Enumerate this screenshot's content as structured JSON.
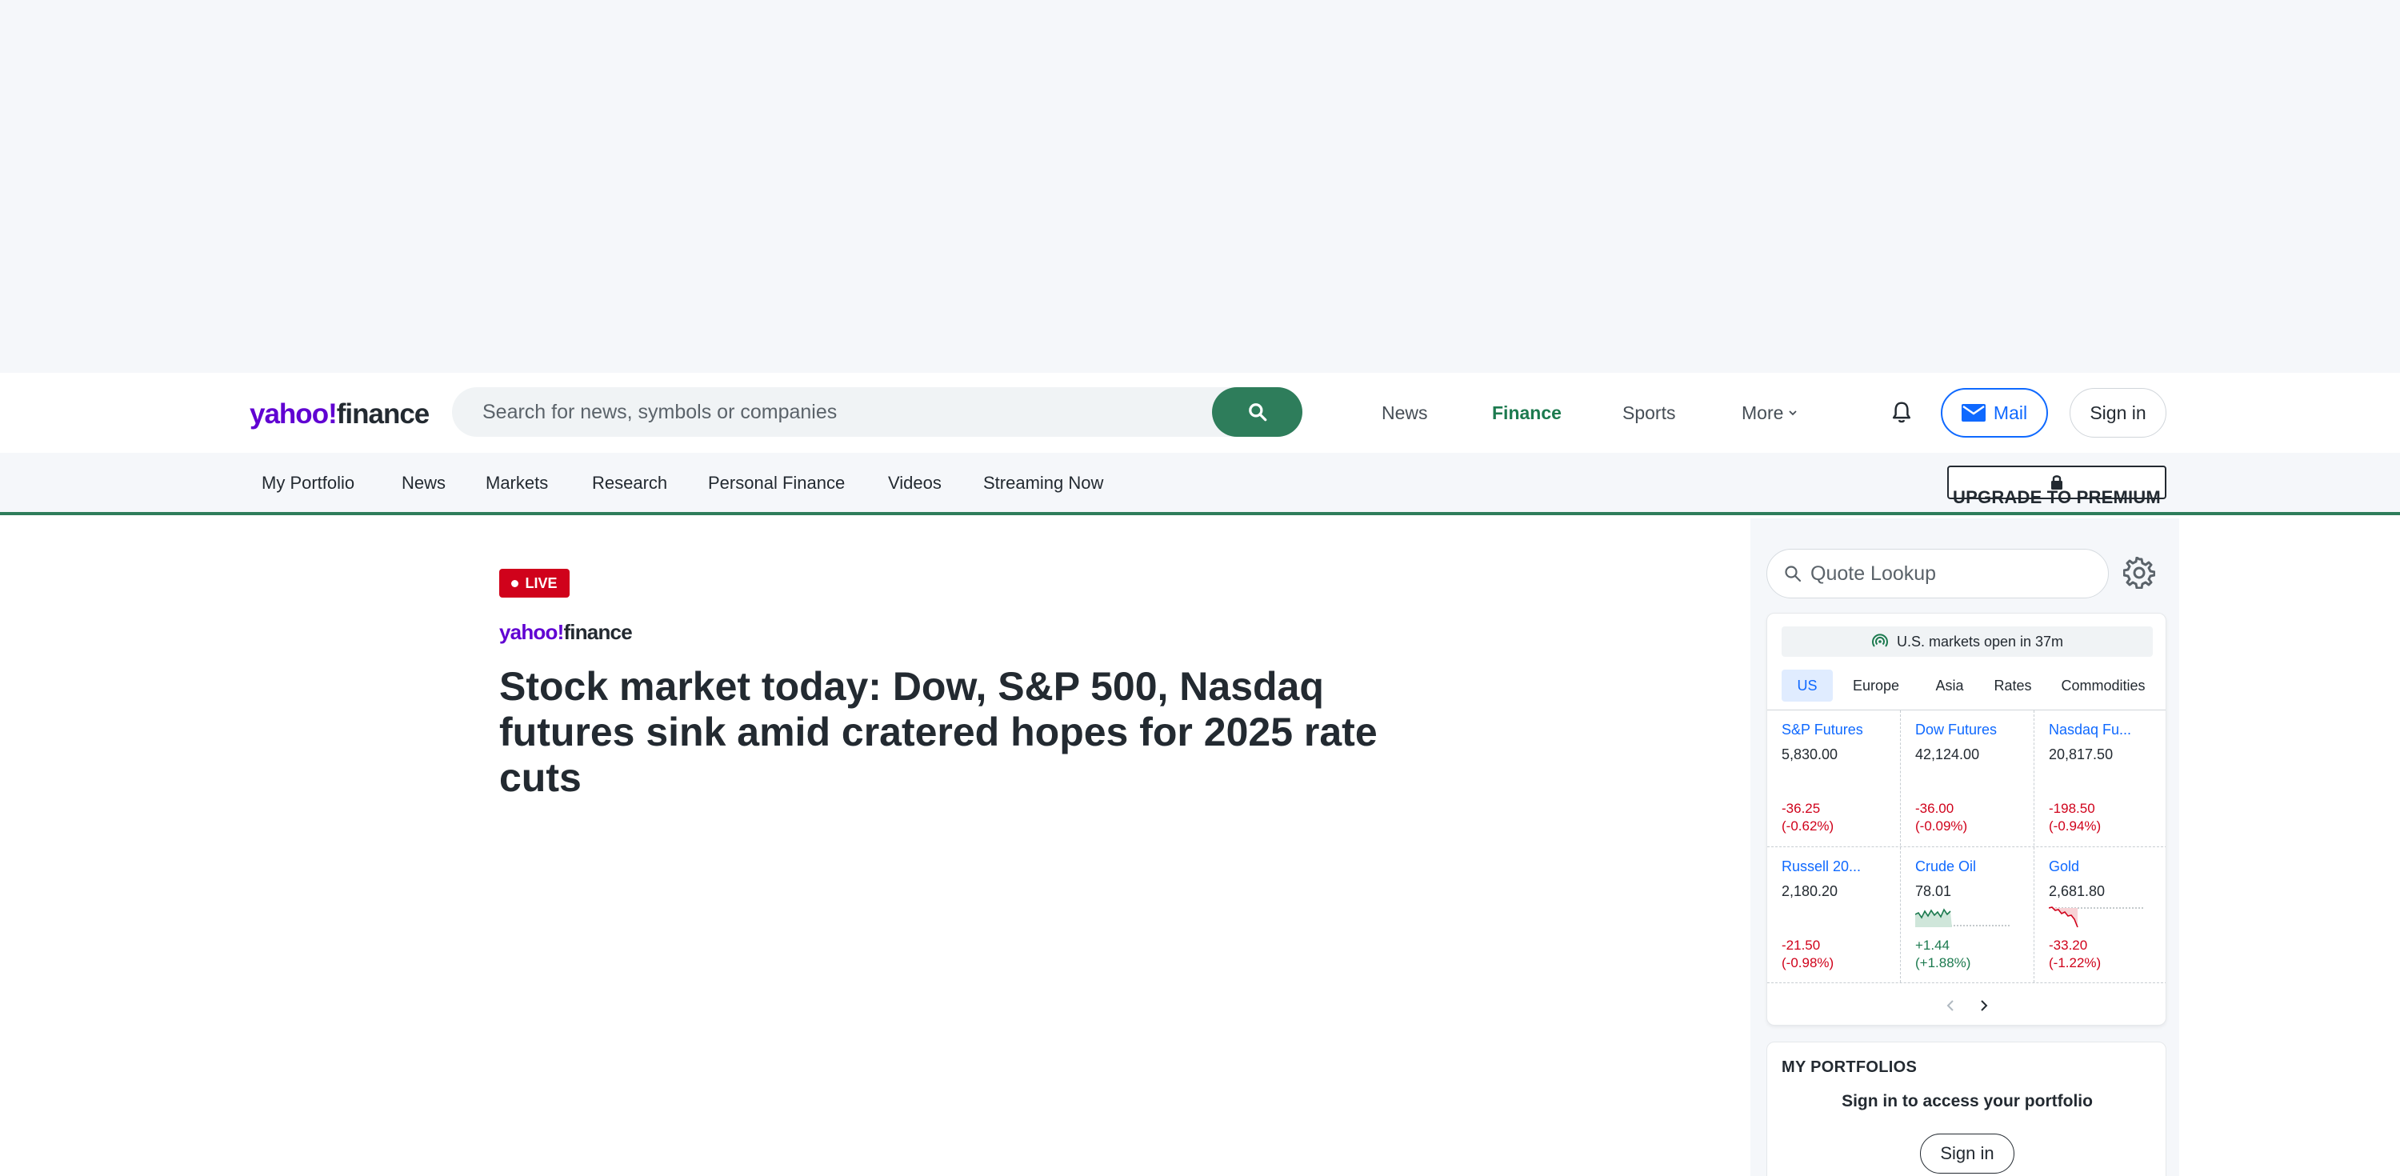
{
  "header": {
    "logo_text_a": "yahoo!",
    "logo_text_b": "finance",
    "search_placeholder": "Search for news, symbols or companies",
    "nav": {
      "news": "News",
      "finance": "Finance",
      "sports": "Sports",
      "more": "More"
    },
    "mail_label": "Mail",
    "signin_label": "Sign in"
  },
  "subnav": {
    "items": [
      "My Portfolio",
      "News",
      "Markets",
      "Research",
      "Personal Finance",
      "Videos",
      "Streaming Now"
    ],
    "upgrade_label": "UPGRADE TO PREMIUM"
  },
  "article": {
    "live_label": "LIVE",
    "source_a": "yahoo!",
    "source_b": "finance",
    "headline": "Stock market today: Dow, S&P 500, Nasdaq futures sink amid cratered hopes for 2025 rate cuts"
  },
  "sidebar": {
    "quote_placeholder": "Quote Lookup",
    "market_status": "U.S. markets open in 37m",
    "tabs": [
      "US",
      "Europe",
      "Asia",
      "Rates",
      "Commodities"
    ],
    "quotes": [
      {
        "name": "S&P Futures",
        "price": "5,830.00",
        "change": "-36.25",
        "pct": "(-0.62%)",
        "direction": "down"
      },
      {
        "name": "Dow Futures",
        "price": "42,124.00",
        "change": "-36.00",
        "pct": "(-0.09%)",
        "direction": "down"
      },
      {
        "name": "Nasdaq Fu...",
        "price": "20,817.50",
        "change": "-198.50",
        "pct": "(-0.94%)",
        "direction": "down"
      },
      {
        "name": "Russell 20...",
        "price": "2,180.20",
        "change": "-21.50",
        "pct": "(-0.98%)",
        "direction": "down"
      },
      {
        "name": "Crude Oil",
        "price": "78.01",
        "change": "+1.44",
        "pct": "(+1.88%)",
        "direction": "up"
      },
      {
        "name": "Gold",
        "price": "2,681.80",
        "change": "-33.20",
        "pct": "(-1.22%)",
        "direction": "down"
      }
    ],
    "portfolio": {
      "title": "MY PORTFOLIOS",
      "subtitle": "Sign in to access your portfolio",
      "signin_label": "Sign in"
    }
  },
  "colors": {
    "brand_purple": "#6001d2",
    "finance_green": "#2e7d5b",
    "link_blue": "#0f69ff",
    "negative_red": "#d0021b",
    "positive_green": "#1c7a4f"
  }
}
